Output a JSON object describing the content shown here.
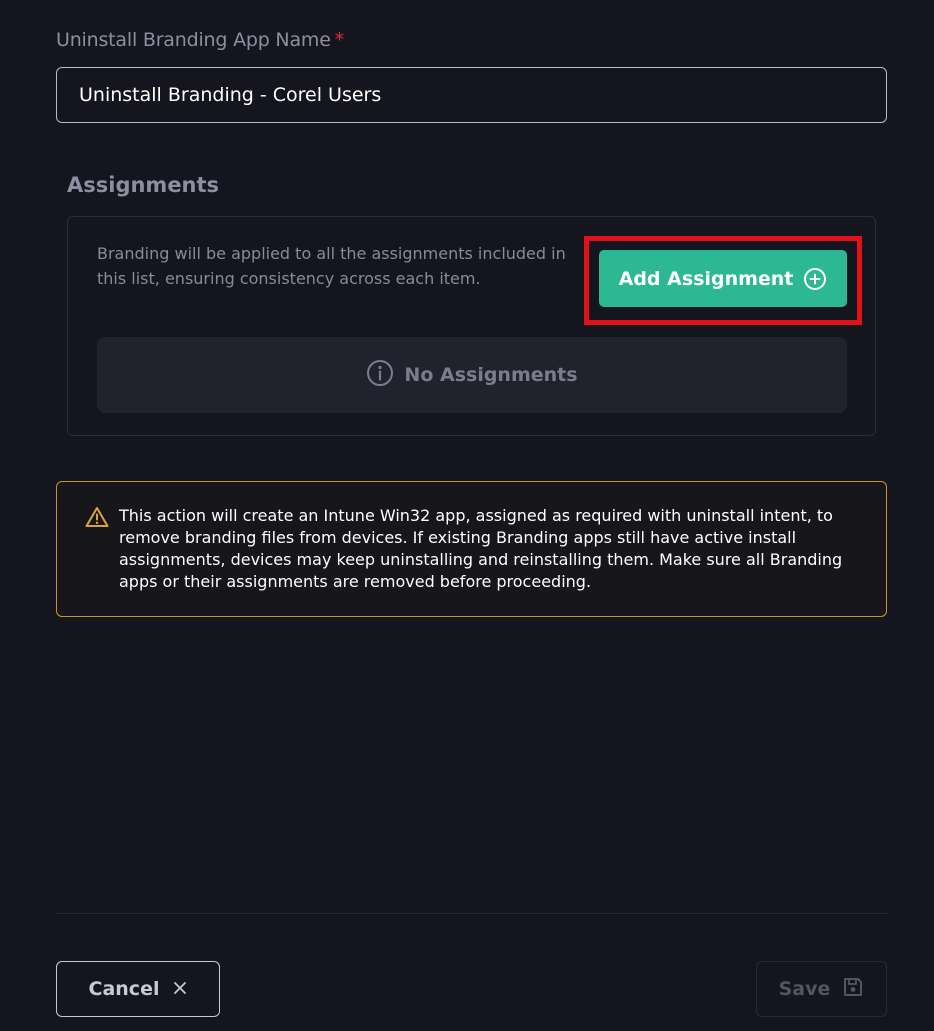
{
  "form": {
    "app_name_label": "Uninstall Branding App Name",
    "required_marker": "*",
    "app_name_value": "Uninstall Branding - Corel Users"
  },
  "assignments": {
    "title": "Assignments",
    "description": "Branding will be applied to all the assignments included in this list, ensuring consistency across each item.",
    "add_button_label": "Add Assignment",
    "add_button_icon": "plus-circle-icon",
    "empty_icon": "info-circle-icon",
    "empty_text": "No Assignments"
  },
  "warning": {
    "icon": "warning-triangle-icon",
    "text": "This action will create an Intune Win32 app, assigned as required with uninstall intent, to remove branding files from devices. If existing Branding apps still have active install assignments, devices may keep uninstalling and reinstalling them. Make sure all Branding apps or their assignments are removed before proceeding."
  },
  "footer": {
    "cancel_label": "Cancel",
    "cancel_icon": "close-icon",
    "save_label": "Save",
    "save_icon": "save-disk-icon"
  },
  "colors": {
    "background": "#15151f",
    "accent_green": "#2bb893",
    "highlight_red": "#e3101a",
    "warning_border": "#c8952a",
    "required_red": "#e0303a"
  }
}
